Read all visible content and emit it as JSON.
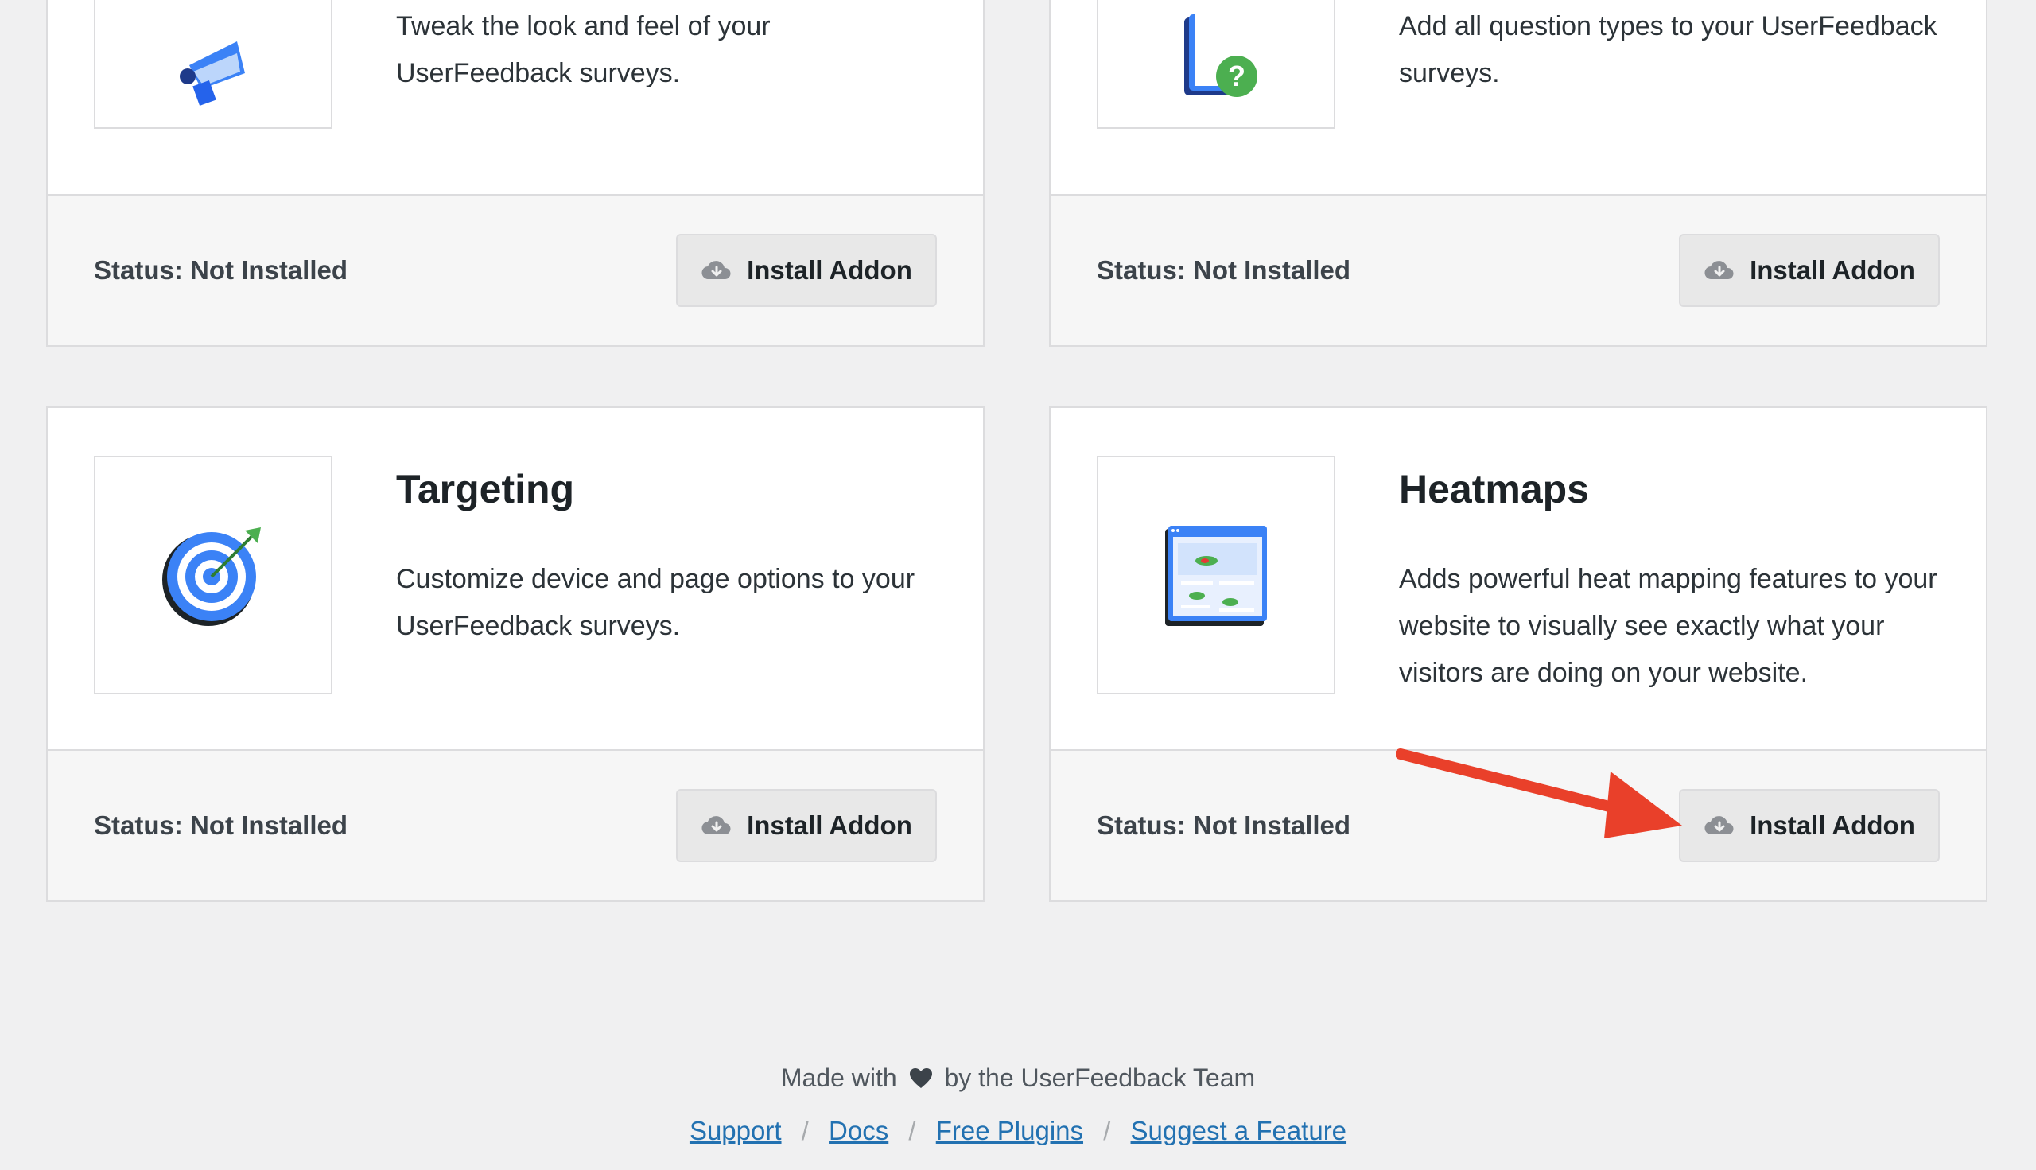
{
  "cards": [
    {
      "id": "customizations",
      "description": "Tweak the look and feel of your UserFeedback surveys.",
      "status": "Status: Not Installed",
      "button": "Install Addon",
      "icon": "megaphone-icon"
    },
    {
      "id": "question-types",
      "description": "Add all question types to your UserFeedback surveys.",
      "status": "Status: Not Installed",
      "button": "Install Addon",
      "icon": "question-document-icon"
    },
    {
      "id": "targeting",
      "title": "Targeting",
      "description": "Customize device and page options to your UserFeedback surveys.",
      "status": "Status: Not Installed",
      "button": "Install Addon",
      "icon": "target-icon"
    },
    {
      "id": "heatmaps",
      "title": "Heatmaps",
      "description": "Adds powerful heat mapping features to your website to visually see exactly what your visitors are doing on your website.",
      "status": "Status: Not Installed",
      "button": "Install Addon",
      "icon": "heatmap-window-icon"
    }
  ],
  "footer": {
    "made_with_prefix": "Made with",
    "heart_icon": "heart-icon",
    "made_with_suffix": "by the UserFeedback Team",
    "links": [
      "Support",
      "Docs",
      "Free Plugins",
      "Suggest a Feature"
    ],
    "separator": "/"
  },
  "colors": {
    "page_background": "#f0f0f1",
    "link": "#2271b1",
    "annotation_arrow": "#e9402a",
    "icon_blue": "#3b82f6",
    "icon_green": "#4caf50"
  },
  "annotation": {
    "arrow_icon": "red-arrow-icon",
    "points_to": "heatmaps install button"
  }
}
